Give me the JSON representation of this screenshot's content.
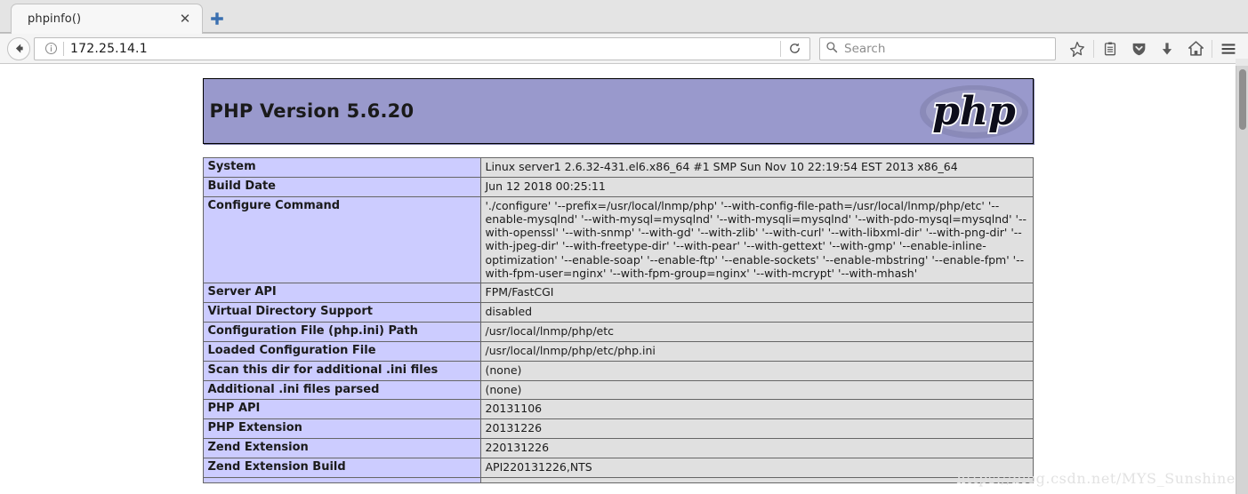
{
  "browser": {
    "tab": {
      "title": "phpinfo()",
      "close_label": "✕"
    },
    "newtab_name": "new-tab-icon",
    "url": "172.25.14.1",
    "search_placeholder": "Search",
    "toolbar_icons": [
      "bookmark-star-icon",
      "reader-list-icon",
      "pocket-shield-icon",
      "download-arrow-icon",
      "home-icon",
      "hamburger-menu-icon"
    ]
  },
  "page": {
    "header": {
      "version_title": "PHP Version 5.6.20",
      "logo_text": "php",
      "header_color": "#9999cc",
      "label_cell_color": "#ccccff",
      "value_cell_color": "#e0e0e0"
    },
    "rows": [
      {
        "key": "System",
        "value": "Linux server1 2.6.32-431.el6.x86_64 #1 SMP Sun Nov 10 22:19:54 EST 2013 x86_64"
      },
      {
        "key": "Build Date",
        "value": "Jun 12 2018 00:25:11"
      },
      {
        "key": "Configure Command",
        "value": "'./configure'  '--prefix=/usr/local/lnmp/php'  '--with-config-file-path=/usr/local/lnmp/php/etc'  '--enable-mysqlnd'  '--with-mysql=mysqlnd'  '--with-mysqli=mysqlnd'  '--with-pdo-mysql=mysqlnd'  '--with-openssl'  '--with-snmp'  '--with-gd'  '--with-zlib'  '--with-curl'  '--with-libxml-dir'  '--with-png-dir'  '--with-jpeg-dir'  '--with-freetype-dir'  '--with-pear'  '--with-gettext'  '--with-gmp'  '--enable-inline-optimization'  '--enable-soap'  '--enable-ftp'  '--enable-sockets'  '--enable-mbstring'  '--enable-fpm'  '--with-fpm-user=nginx'  '--with-fpm-group=nginx'  '--with-mcrypt'  '--with-mhash'"
      },
      {
        "key": "Server API",
        "value": "FPM/FastCGI"
      },
      {
        "key": "Virtual Directory Support",
        "value": "disabled"
      },
      {
        "key": "Configuration File (php.ini) Path",
        "value": "/usr/local/lnmp/php/etc"
      },
      {
        "key": "Loaded Configuration File",
        "value": "/usr/local/lnmp/php/etc/php.ini"
      },
      {
        "key": "Scan this dir for additional .ini files",
        "value": "(none)"
      },
      {
        "key": "Additional .ini files parsed",
        "value": "(none)"
      },
      {
        "key": "PHP API",
        "value": "20131106"
      },
      {
        "key": "PHP Extension",
        "value": "20131226"
      },
      {
        "key": "Zend Extension",
        "value": "220131226"
      },
      {
        "key": "Zend Extension Build",
        "value": "API220131226,NTS"
      },
      {
        "key": "",
        "value": ""
      }
    ]
  },
  "watermark": "https://blog.csdn.net/MYS_Sunshine"
}
